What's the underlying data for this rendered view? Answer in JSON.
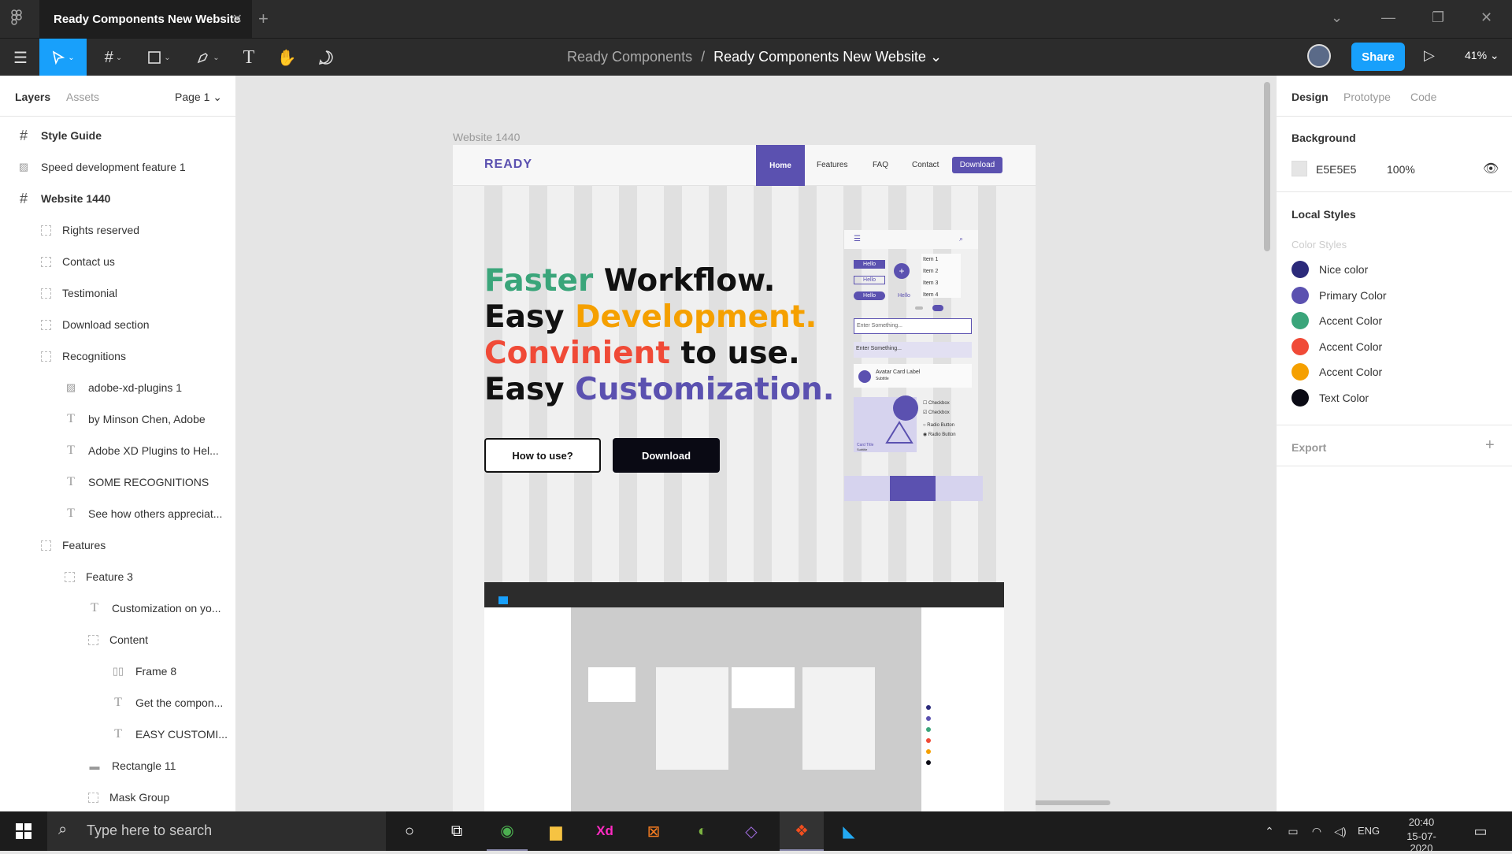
{
  "titlebar": {
    "tab_title": "Ready Components New Website",
    "close": "✕",
    "new_tab": "+"
  },
  "toolbar": {
    "breadcrumb_parent": "Ready Components",
    "breadcrumb_sep": "/",
    "breadcrumb_file": "Ready Components New Website ⌄",
    "share": "Share",
    "zoom": "41%"
  },
  "left": {
    "tabs": [
      "Layers",
      "Assets"
    ],
    "page": "Page 1 ⌄",
    "layers": [
      {
        "label": "Style Guide",
        "bold": true,
        "indent": 0,
        "icon": "frame"
      },
      {
        "label": "Speed development feature 1",
        "indent": 0,
        "icon": "image"
      },
      {
        "label": "Website 1440",
        "bold": true,
        "indent": 0,
        "icon": "frame"
      },
      {
        "label": "Rights reserved",
        "indent": 1,
        "icon": "group"
      },
      {
        "label": "Contact us",
        "indent": 1,
        "icon": "group"
      },
      {
        "label": "Testimonial",
        "indent": 1,
        "icon": "group"
      },
      {
        "label": "Download section",
        "indent": 1,
        "icon": "group"
      },
      {
        "label": "Recognitions",
        "indent": 1,
        "icon": "group"
      },
      {
        "label": "adobe-xd-plugins 1",
        "indent": 2,
        "icon": "image"
      },
      {
        "label": "by Minson Chen, Adobe",
        "indent": 2,
        "icon": "text"
      },
      {
        "label": "Adobe XD Plugins to Hel...",
        "indent": 2,
        "icon": "text"
      },
      {
        "label": "SOME RECOGNITIONS",
        "indent": 2,
        "icon": "text"
      },
      {
        "label": "See how others appreciat...",
        "indent": 2,
        "icon": "text"
      },
      {
        "label": "Features",
        "indent": 1,
        "icon": "group"
      },
      {
        "label": "Feature 3",
        "indent": 2,
        "icon": "group"
      },
      {
        "label": "Customization on yo...",
        "indent": 3,
        "icon": "text"
      },
      {
        "label": "Content",
        "indent": 3,
        "icon": "group"
      },
      {
        "label": "Frame 8",
        "indent": 4,
        "icon": "autolayout"
      },
      {
        "label": "Get the compon...",
        "indent": 4,
        "icon": "text"
      },
      {
        "label": "EASY CUSTOMI...",
        "indent": 4,
        "icon": "text"
      },
      {
        "label": "Rectangle 11",
        "indent": 3,
        "icon": "rect"
      },
      {
        "label": "Mask Group",
        "indent": 3,
        "icon": "group"
      }
    ]
  },
  "right": {
    "tabs": [
      "Design",
      "Prototype",
      "Code"
    ],
    "background_title": "Background",
    "background_hex": "E5E5E5",
    "background_opacity": "100%",
    "local_styles": "Local Styles",
    "color_styles": "Color Styles",
    "styles": [
      {
        "name": "Nice color",
        "color": "#2b2a7a"
      },
      {
        "name": "Primary Color",
        "color": "#5b51b0"
      },
      {
        "name": "Accent Color",
        "color": "#3aa57a"
      },
      {
        "name": "Accent Color",
        "color": "#f04a37"
      },
      {
        "name": "Accent Color",
        "color": "#f5a000"
      },
      {
        "name": "Text Color",
        "color": "#0a0a14"
      }
    ],
    "export": "Export",
    "export_plus": "+"
  },
  "canvas": {
    "frame_label": "Website 1440",
    "site": {
      "logo": "READY",
      "nav": [
        "Home",
        "Features",
        "FAQ",
        "Contact"
      ],
      "nav_download": "Download",
      "hero": [
        [
          {
            "t": "Faster ",
            "c": "#3aa57a"
          },
          {
            "t": "Workflow.",
            "c": "#111"
          }
        ],
        [
          {
            "t": "Easy ",
            "c": "#111"
          },
          {
            "t": "Development.",
            "c": "#f5a000"
          }
        ],
        [
          {
            "t": "Convinient ",
            "c": "#f04a37"
          },
          {
            "t": "to use.",
            "c": "#111"
          }
        ],
        [
          {
            "t": "Easy ",
            "c": "#111"
          },
          {
            "t": "Customization.",
            "c": "#5b51b0"
          }
        ]
      ],
      "btn_how": "How to use?",
      "btn_download": "Download",
      "mock": {
        "btn1": "Hello",
        "btn2": "Hello",
        "btn3": "Hello",
        "btn4": "Hello",
        "items": [
          "Item 1",
          "Item 2",
          "Item 3",
          "Item 4"
        ],
        "input1": "Enter Something...",
        "input2": "Enter Something...",
        "card_label": "Avatar Card Label",
        "card_sub": "Subtitle",
        "card_title": "Card Title",
        "card_title_sub": "Subtitle",
        "checks": [
          "Checkbox",
          "Checkbox",
          "Radio Button",
          "Radio Button"
        ]
      }
    }
  },
  "taskbar": {
    "search": "Type here to search",
    "lang": "ENG",
    "time": "20:40",
    "date": "15-07-2020"
  },
  "help": "?"
}
